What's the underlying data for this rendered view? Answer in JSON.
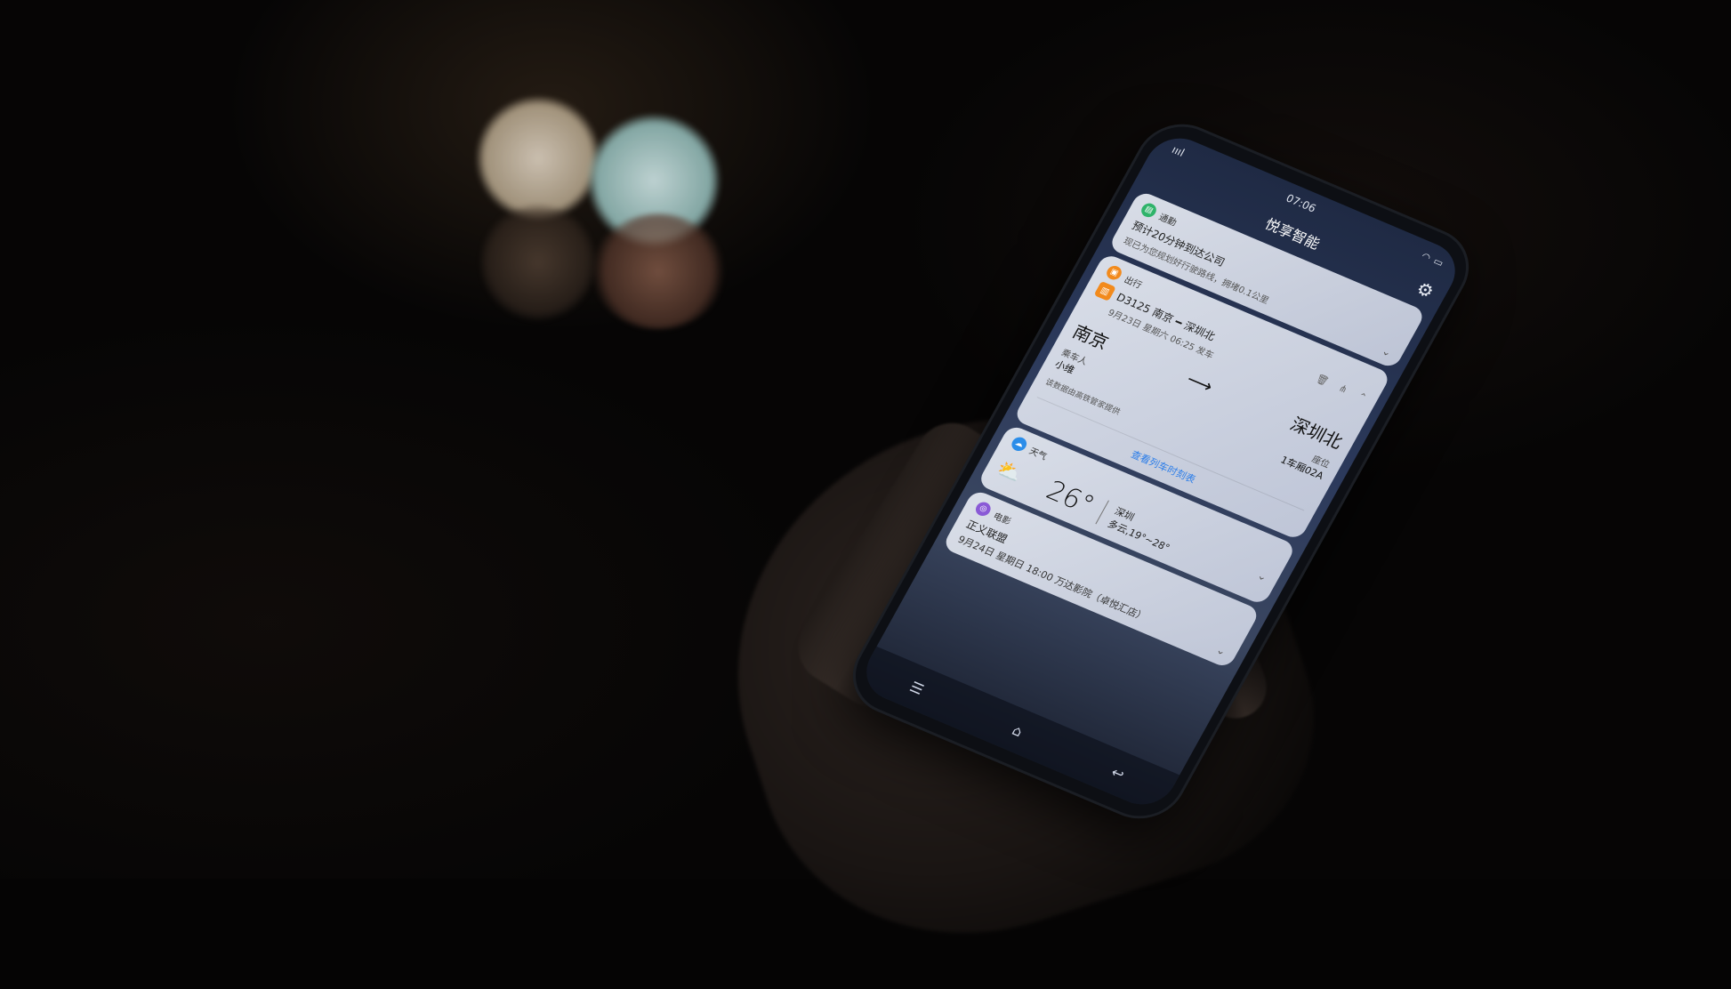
{
  "status": {
    "time": "07:06",
    "signal": "ıııl",
    "wifi": "wifi",
    "battery": "battery"
  },
  "header": {
    "title": "悦享智能",
    "settings_icon": "gear-icon"
  },
  "commute": {
    "app": "通勤",
    "line1": "预计20分钟到达公司",
    "line2": "现已为您规划好行驶路线，拥堵0.1公里"
  },
  "travel": {
    "app": "出行",
    "train": "D3125 南京 ━ 深圳北",
    "date": "9月23日 星期六 06:25 发车",
    "from": "南京",
    "to": "深圳北",
    "passenger_label": "乘车人",
    "passenger": "小维",
    "seat_label": "座位",
    "seat": "1车厢02A",
    "source": "该数据由高铁管家提供",
    "link": "查看列车时刻表"
  },
  "weather": {
    "app": "天气",
    "temp": "26°",
    "city": "深圳",
    "desc": "多云,19°~28°"
  },
  "movie": {
    "app": "电影",
    "title": "正义联盟",
    "detail": "9月24日 星期日 18:00  万达影院（卓悦汇店）"
  },
  "colors": {
    "commute": "#2fb36a",
    "travel": "#f28a1c",
    "weather": "#2b8de9",
    "movie": "#8a5ad6",
    "link": "#2b7de9"
  }
}
